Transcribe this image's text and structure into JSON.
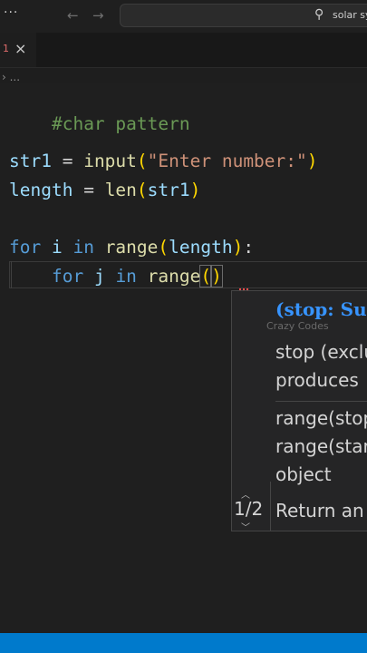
{
  "titlebar": {
    "menu_dots": "···",
    "back_arrow": "←",
    "forward_arrow": "→",
    "search_icon_glyph": "⚲",
    "search_text": "solar sy"
  },
  "tab": {
    "number": "1",
    "close_glyph": "×"
  },
  "breadcrumb": "› ...",
  "code": {
    "line1": "#char pattern",
    "line2": {
      "var": "str1",
      "op": " = ",
      "fn": "input",
      "open": "(",
      "str": "\"Enter number:\"",
      "close": ")"
    },
    "line3": {
      "var": "length",
      "op": " = ",
      "fn": "len",
      "open": "(",
      "arg": "str1",
      "close": ")"
    },
    "line4": {
      "kw1": "for",
      "var": " i ",
      "kw2": "in",
      "fn": " range",
      "open": "(",
      "arg": "length",
      "close": ")",
      "colon": ":"
    },
    "line5": {
      "indent": "    ",
      "kw1": "for",
      "var": " j ",
      "kw2": "in",
      "fn": " range",
      "open": "(",
      "close": ")"
    }
  },
  "popup": {
    "signature": "(stop: Sup",
    "watermark": "Crazy Codes",
    "desc1": "stop (exclu",
    "desc2": "produces",
    "desc3": "range(stop",
    "desc4": "range(star",
    "desc5": "object",
    "desc6": "Return an",
    "counter": "1/2",
    "chev_up": "︿",
    "chev_down": "﹀"
  },
  "colors": {
    "keyword": "#569cd6",
    "function": "#dcdcaa",
    "string": "#ce9178",
    "comment": "#6a9955",
    "variable": "#9cdcfe",
    "statusbar": "#007acc",
    "signature": "#3794ff"
  }
}
